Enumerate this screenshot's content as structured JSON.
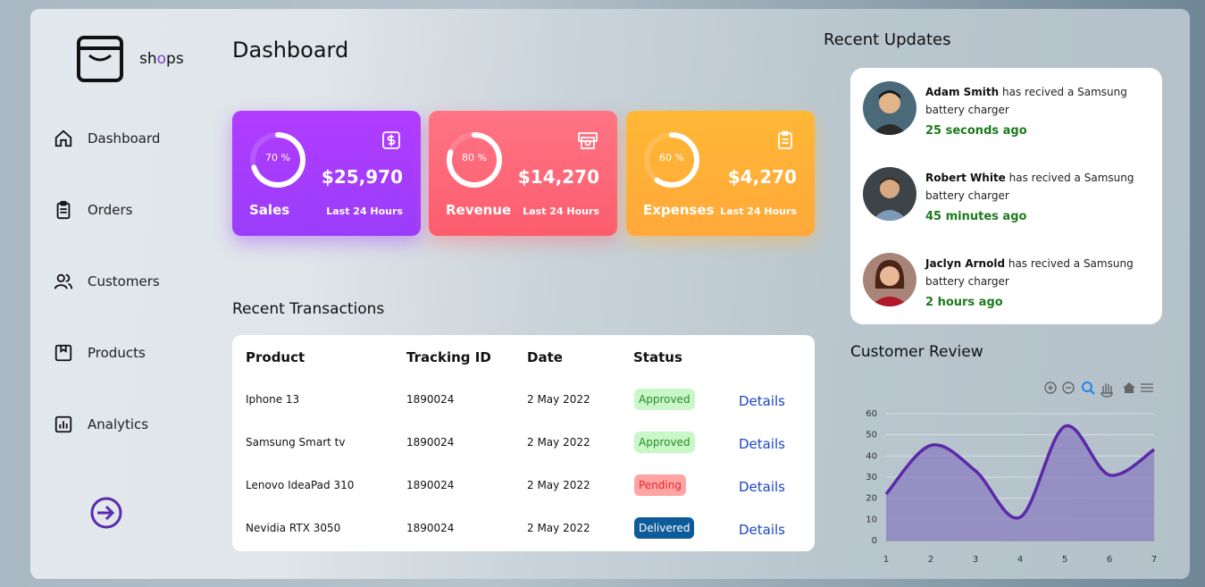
{
  "brand": {
    "name_pre": "sh",
    "name_o": "o",
    "name_post": "ps"
  },
  "sidebar": {
    "items": [
      {
        "label": "Dashboard",
        "icon": "home-icon"
      },
      {
        "label": "Orders",
        "icon": "clipboard-icon"
      },
      {
        "label": "Customers",
        "icon": "users-icon"
      },
      {
        "label": "Products",
        "icon": "box-icon"
      },
      {
        "label": "Analytics",
        "icon": "bar-chart-icon"
      }
    ],
    "logout_icon": "logout-icon"
  },
  "page_title": "Dashboard",
  "cards": [
    {
      "name": "Sales",
      "percent": 70,
      "percent_label": "70 %",
      "value": "$25,970",
      "sub": "Last 24 Hours",
      "icon": "dollar-icon",
      "color": "#a93cfd"
    },
    {
      "name": "Revenue",
      "percent": 80,
      "percent_label": "80 %",
      "value": "$14,270",
      "sub": "Last 24 Hours",
      "icon": "money-icon",
      "color": "#fd6979"
    },
    {
      "name": "Expenses",
      "percent": 60,
      "percent_label": "60 %",
      "value": "$4,270",
      "sub": "Last 24 Hours",
      "icon": "clipboard-icon",
      "color": "#ffb036"
    }
  ],
  "transactions": {
    "title": "Recent Transactions",
    "headers": [
      "Product",
      "Tracking ID",
      "Date",
      "Status"
    ],
    "rows": [
      {
        "product": "Iphone 13",
        "tracking": "1890024",
        "date": "2 May 2022",
        "status": "Approved",
        "action": "Details"
      },
      {
        "product": "Samsung Smart tv",
        "tracking": "1890024",
        "date": "2 May 2022",
        "status": "Approved",
        "action": "Details"
      },
      {
        "product": "Lenovo IdeaPad 310",
        "tracking": "1890024",
        "date": "2 May 2022",
        "status": "Pending",
        "action": "Details"
      },
      {
        "product": "Nevidia RTX 3050",
        "tracking": "1890024",
        "date": "2 May 2022",
        "status": "Delivered",
        "action": "Details"
      }
    ]
  },
  "updates": {
    "title": "Recent Updates",
    "items": [
      {
        "name": "Adam Smith",
        "text": " has recived a Samsung battery charger",
        "time": "25 seconds ago"
      },
      {
        "name": "Robert White",
        "text": " has recived a Samsung battery charger",
        "time": "45 minutes ago"
      },
      {
        "name": "Jaclyn Arnold",
        "text": " has recived a Samsung battery charger",
        "time": "2 hours ago"
      }
    ]
  },
  "review": {
    "title": "Customer Review",
    "toolbar": [
      "zoom-in-icon",
      "zoom-out-icon",
      "selection-zoom-icon",
      "pan-hand-icon",
      "reset-home-icon",
      "menu-icon"
    ]
  },
  "chart_data": {
    "type": "area",
    "title": "",
    "x": [
      1,
      2,
      3,
      4,
      5,
      6,
      7
    ],
    "series": [
      {
        "values": [
          22,
          45,
          33,
          11,
          54,
          31,
          43
        ]
      }
    ],
    "ylim": [
      0,
      60
    ],
    "yticks": [
      0,
      10,
      20,
      30,
      40,
      50,
      60
    ],
    "grid": true,
    "colors": {
      "line": "#5b2aa8",
      "fill": "#8a7ec0"
    }
  }
}
